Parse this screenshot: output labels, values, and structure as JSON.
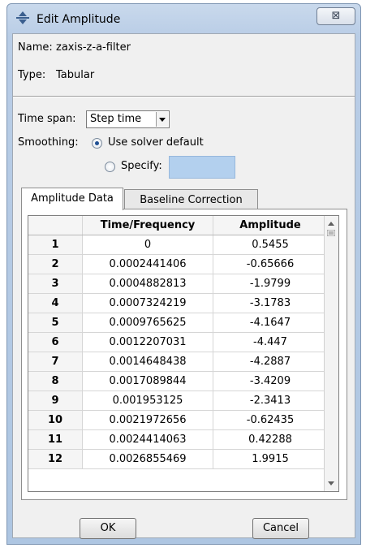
{
  "window": {
    "title": "Edit Amplitude",
    "close_glyph": "⊠"
  },
  "info": {
    "name_label": "Name:",
    "name_value": "zaxis-z-a-filter",
    "type_label": "Type:",
    "type_value": "Tabular"
  },
  "time_span": {
    "label": "Time span:",
    "value": "Step time"
  },
  "smoothing": {
    "label": "Smoothing:",
    "options": [
      {
        "label": "Use solver default",
        "selected": true
      },
      {
        "label": "Specify:",
        "selected": false
      }
    ],
    "specify_value": ""
  },
  "tabs": [
    {
      "label": "Amplitude Data",
      "active": true
    },
    {
      "label": "Baseline Correction",
      "active": false
    }
  ],
  "table": {
    "columns": [
      "Time/Frequency",
      "Amplitude"
    ],
    "rows": [
      {
        "n": "1",
        "time": "0",
        "amp": "0.5455"
      },
      {
        "n": "2",
        "time": "0.0002441406",
        "amp": "-0.65666"
      },
      {
        "n": "3",
        "time": "0.0004882813",
        "amp": "-1.9799"
      },
      {
        "n": "4",
        "time": "0.0007324219",
        "amp": "-3.1783"
      },
      {
        "n": "5",
        "time": "0.0009765625",
        "amp": "-4.1647"
      },
      {
        "n": "6",
        "time": "0.0012207031",
        "amp": "-4.447"
      },
      {
        "n": "7",
        "time": "0.0014648438",
        "amp": "-4.2887"
      },
      {
        "n": "8",
        "time": "0.0017089844",
        "amp": "-3.4209"
      },
      {
        "n": "9",
        "time": "0.001953125",
        "amp": "-2.3413"
      },
      {
        "n": "10",
        "time": "0.0021972656",
        "amp": "-0.62435"
      },
      {
        "n": "11",
        "time": "0.0024414063",
        "amp": "0.42288"
      },
      {
        "n": "12",
        "time": "0.0026855469",
        "amp": "1.9915"
      }
    ]
  },
  "buttons": {
    "ok": "OK",
    "cancel": "Cancel"
  },
  "icons": {
    "app": "arrows-icon",
    "close": "close-icon",
    "dropdown": "chevron-down-icon"
  },
  "colors": {
    "title_bg": "#b9cde6",
    "client_bg": "#f0f0f0",
    "specify_field": "#b3d0ee",
    "radio_dot": "#1f4f93"
  }
}
